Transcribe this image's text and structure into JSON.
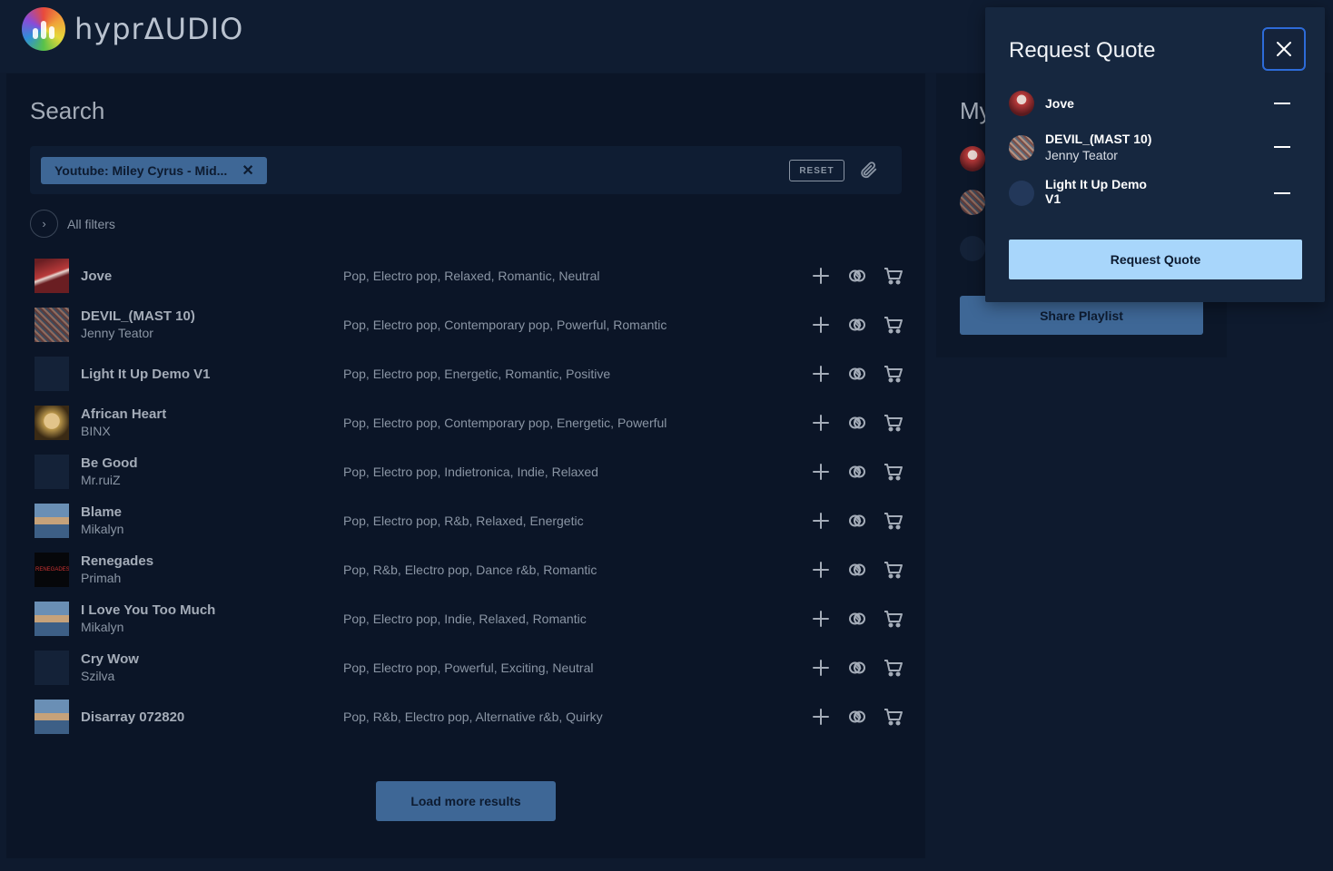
{
  "app": {
    "logo_text": "hyprΔUDIO"
  },
  "search": {
    "title": "Search",
    "chip_label": "Youtube: Miley Cyrus - Mid...",
    "reset_label": "RESET",
    "all_filters_label": "All filters",
    "load_more_label": "Load more results"
  },
  "tracks": [
    {
      "title": "Jove",
      "artist": "",
      "tags": "Pop,  Electro pop,  Relaxed,  Romantic,  Neutral"
    },
    {
      "title": "DEVIL_(MAST 10)",
      "artist": "Jenny Teator",
      "tags": "Pop,  Electro pop,  Contemporary pop,  Powerful,  Romantic"
    },
    {
      "title": "Light It Up Demo V1",
      "artist": "",
      "tags": "Pop,  Electro pop,  Energetic,  Romantic,  Positive"
    },
    {
      "title": "African Heart",
      "artist": "BINX",
      "tags": "Pop,  Electro pop,  Contemporary pop,  Energetic,  Powerful"
    },
    {
      "title": "Be Good",
      "artist": "Mr.ruiZ",
      "tags": "Pop,  Electro pop,  Indietronica,  Indie,  Relaxed"
    },
    {
      "title": "Blame",
      "artist": "Mikalyn",
      "tags": "Pop,  Electro pop,  R&b,  Relaxed,  Energetic"
    },
    {
      "title": "Renegades",
      "artist": "Primah",
      "tags": "Pop,  R&b,  Electro pop,  Dance r&b,  Romantic"
    },
    {
      "title": "I Love You Too Much",
      "artist": "Mikalyn",
      "tags": "Pop,  Electro pop,  Indie,  Relaxed,  Romantic"
    },
    {
      "title": "Cry Wow",
      "artist": "Szilva",
      "tags": "Pop,  Electro pop,  Powerful,  Exciting,  Neutral"
    },
    {
      "title": "Disarray 072820",
      "artist": "",
      "tags": "Pop,  R&b,  Electro pop,  Alternative r&b,  Quirky"
    }
  ],
  "renegades_thumb_text": "RENEGADES",
  "playlist": {
    "title_visible": "My",
    "share_label": "Share Playlist"
  },
  "quote_modal": {
    "title": "Request Quote",
    "items": [
      {
        "title": "Jove",
        "artist": ""
      },
      {
        "title": "DEVIL_(MAST 10)",
        "artist": "Jenny Teator"
      },
      {
        "title": "Light It Up Demo\nV1",
        "artist": ""
      }
    ],
    "request_label": "Request Quote"
  },
  "colors": {
    "background": "#0e1a2e",
    "panel": "#0b1527",
    "modal": "#16273f",
    "button_dim": "#3e6796",
    "button_bright": "#a8d6fb",
    "close_border": "#2d6bd8"
  }
}
